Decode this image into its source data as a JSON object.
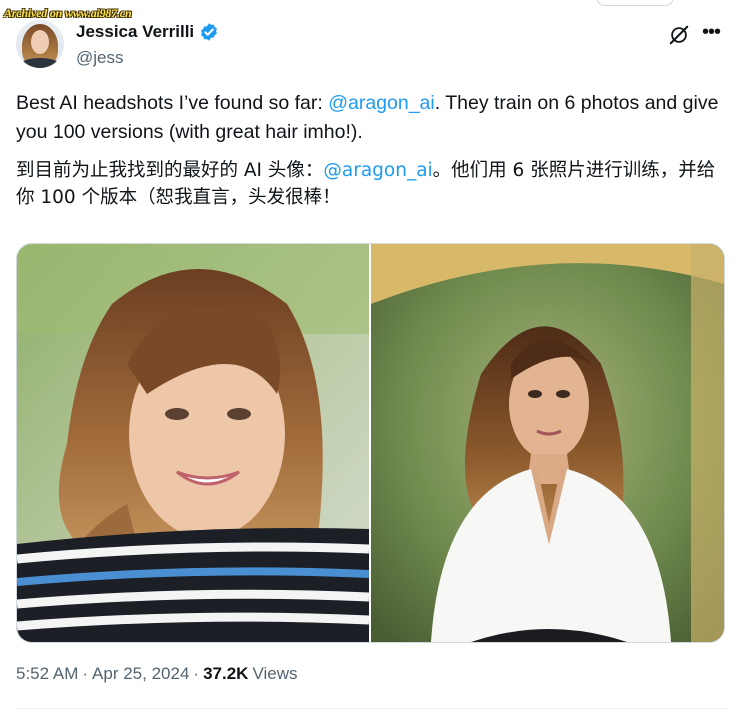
{
  "watermark": {
    "text": "Archived on www.ai987.cn"
  },
  "author": {
    "display_name": "Jessica Verrilli",
    "handle": "@jess",
    "verified": true
  },
  "icons": {
    "verified": "verified-badge-icon",
    "grok": "grok-icon",
    "more": "more-options-icon"
  },
  "colors": {
    "mention": "#1d9bf0",
    "verified": "#1d9bf0",
    "secondary_text": "#536471"
  },
  "tweet": {
    "en": {
      "before": "Best AI headshots I’ve found so far: ",
      "mention": "@aragon_ai",
      "after": ". They train on 6 photos and give you 100 versions (with great hair imho!)."
    },
    "zh": {
      "before": "到目前为止我找到的最好的 AI 头像：",
      "mention": "@aragon_ai",
      "after": "。他们用 6 张照片进行训练，并给你 100 个版本（恕我直言，头发很棒！"
    }
  },
  "media": {
    "images": [
      {
        "name": "headshot-photo-striped-shirt"
      },
      {
        "name": "headshot-photo-white-blouse"
      }
    ]
  },
  "meta": {
    "time": "5:52 AM",
    "sep1": "·",
    "date": "Apr 25, 2024",
    "sep2": "·",
    "views_count": "37.2K",
    "views_label": "Views"
  }
}
